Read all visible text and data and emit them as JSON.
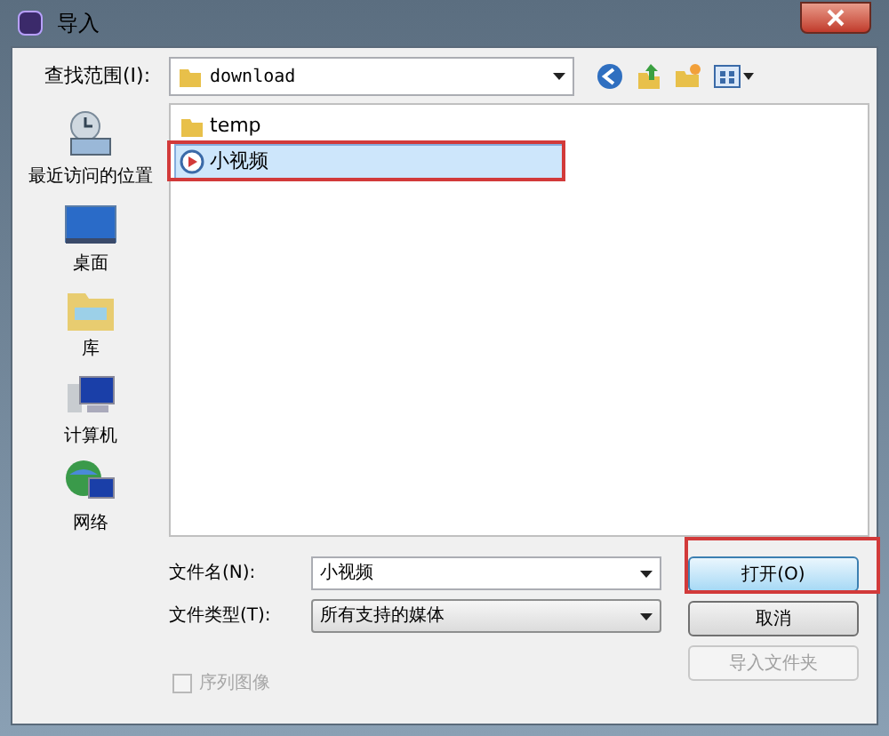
{
  "window": {
    "title": "导入"
  },
  "look_in": {
    "label": "查找范围(I):",
    "value": "download"
  },
  "places": [
    {
      "kind": "recent",
      "label": "最近访问的位置"
    },
    {
      "kind": "desktop",
      "label": "桌面"
    },
    {
      "kind": "library",
      "label": "库"
    },
    {
      "kind": "computer",
      "label": "计算机"
    },
    {
      "kind": "network",
      "label": "网络"
    }
  ],
  "files": [
    {
      "kind": "folder",
      "name": "temp",
      "selected": false
    },
    {
      "kind": "video",
      "name": "小视频",
      "selected": true
    }
  ],
  "file_name": {
    "label": "文件名(N):",
    "value": "小视频"
  },
  "file_type": {
    "label": "文件类型(T):",
    "value": "所有支持的媒体"
  },
  "buttons": [
    {
      "label": "打开(O)",
      "default": true,
      "disabled": false
    },
    {
      "label": "取消",
      "default": false,
      "disabled": false
    },
    {
      "label": "导入文件夹",
      "default": false,
      "disabled": true
    }
  ],
  "sequence": {
    "label": "序列图像",
    "checked": false,
    "disabled": true
  }
}
